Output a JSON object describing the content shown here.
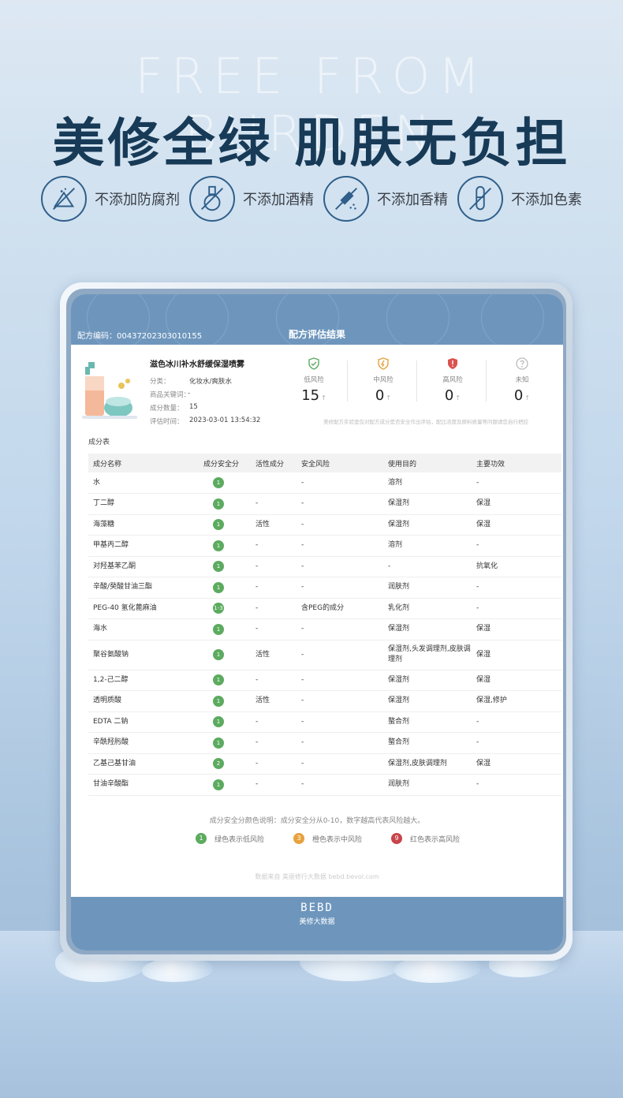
{
  "hero": {
    "english": "FREE FROM BURDEN",
    "chinese": "美修全绿 肌肤无负担"
  },
  "features": [
    {
      "icon": "no-preservative-icon",
      "label": "不添加防腐剂"
    },
    {
      "icon": "no-alcohol-icon",
      "label": "不添加酒精"
    },
    {
      "icon": "no-fragrance-icon",
      "label": "不添加香精"
    },
    {
      "icon": "no-colorant-icon",
      "label": "不添加色素"
    }
  ],
  "report": {
    "formula_code": "配方编码：00437202303010155",
    "title": "配方评估结果",
    "product_name": "滋色冰川补水舒缓保湿喷雾",
    "meta": [
      {
        "label": "分类：",
        "value": "化妆水/爽肤水"
      },
      {
        "label": "商品关键词：",
        "value": "-"
      },
      {
        "label": "成分数量：",
        "value": "15"
      },
      {
        "label": "评估时间：",
        "value": "2023-03-01 13:54:32"
      }
    ],
    "risks": [
      {
        "label": "低风险",
        "value": "15",
        "color": "#5cab5f",
        "icon": "shield-check-icon"
      },
      {
        "label": "中风险",
        "value": "0",
        "color": "#e6a23c",
        "icon": "shield-warning-icon"
      },
      {
        "label": "高风险",
        "value": "0",
        "color": "#d9534f",
        "icon": "shield-alert-icon"
      },
      {
        "label": "未知",
        "value": "0",
        "color": "#bbbbbb",
        "icon": "question-icon"
      }
    ],
    "risk_arrow": "↑",
    "note": "美修配方实验室仅对配方成分是否安全作出评估，配比浓度及原料质量等问题请您自行把控",
    "section_title": "成分表",
    "columns": [
      "成分名称",
      "成分安全分",
      "活性成分",
      "安全风险",
      "使用目的",
      "主要功效"
    ],
    "rows": [
      [
        "水",
        "1",
        "",
        "-",
        "溶剂",
        "-"
      ],
      [
        "丁二醇",
        "1",
        "-",
        "-",
        "保湿剂",
        "保湿"
      ],
      [
        "海藻糖",
        "1",
        "活性",
        "-",
        "保湿剂",
        "保湿"
      ],
      [
        "甲基丙二醇",
        "1",
        "-",
        "-",
        "溶剂",
        "-"
      ],
      [
        "对羟基苯乙酮",
        "1",
        "-",
        "-",
        "-",
        "抗氧化"
      ],
      [
        "辛酸/癸酸甘油三酯",
        "1",
        "-",
        "-",
        "润肤剂",
        "-"
      ],
      [
        "PEG-40 氢化蓖麻油",
        "1-3",
        "-",
        "含PEG的成分",
        "乳化剂",
        "-"
      ],
      [
        "海水",
        "1",
        "-",
        "-",
        "保湿剂",
        "保湿"
      ],
      [
        "聚谷氨酸钠",
        "1",
        "活性",
        "-",
        "保湿剂,头发调理剂,皮肤调理剂",
        "保湿"
      ],
      [
        "1,2-己二醇",
        "1",
        "-",
        "-",
        "保湿剂",
        "保湿"
      ],
      [
        "透明质酸",
        "1",
        "活性",
        "-",
        "保湿剂",
        "保湿,修护"
      ],
      [
        "EDTA 二钠",
        "1",
        "-",
        "-",
        "螯合剂",
        "-"
      ],
      [
        "辛酰羟肟酸",
        "1",
        "-",
        "-",
        "螯合剂",
        "-"
      ],
      [
        "乙基己基甘油",
        "2",
        "-",
        "-",
        "保湿剂,皮肤调理剂",
        "保湿"
      ],
      [
        "甘油辛酸酯",
        "1",
        "-",
        "-",
        "润肤剂",
        "-"
      ]
    ],
    "legend_title": "成分安全分颜色说明：成分安全分从0-10，数字越高代表风险越大。",
    "legend": [
      {
        "num": "1",
        "label": "绿色表示低风险",
        "color": "#5cab5f"
      },
      {
        "num": "3",
        "label": "橙色表示中风险",
        "color": "#e6a23c"
      },
      {
        "num": "9",
        "label": "红色表示高风险",
        "color": "#c9444a"
      }
    ],
    "source": "数据来自 美丽修行大数据 bebd.bevol.com",
    "logo": "BEBD",
    "logo_sub": "美修大数据"
  }
}
